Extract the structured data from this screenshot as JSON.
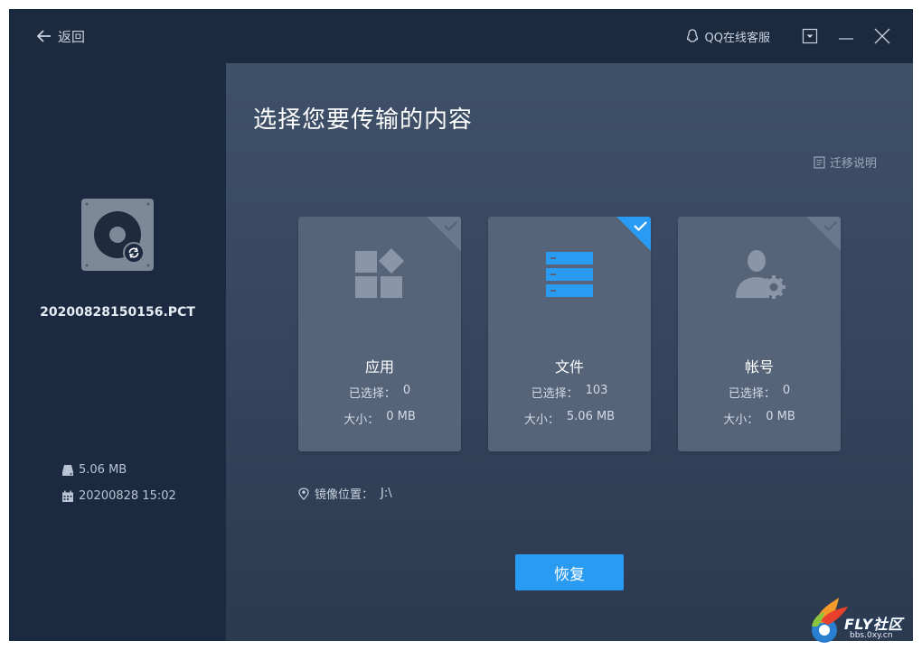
{
  "titlebar": {
    "back_label": "返回",
    "support_label": "QQ在线客服"
  },
  "sidebar": {
    "file_name": "20200828150156.PCT",
    "size": "5.06 MB",
    "date": "20200828 15:02"
  },
  "main": {
    "title": "选择您要传输的内容",
    "help_label": "迁移说明",
    "selected_label": "已选择：",
    "size_label": "大小：",
    "cards": [
      {
        "title": "应用",
        "selected": "0",
        "size": "0 MB",
        "checked": false
      },
      {
        "title": "文件",
        "selected": "103",
        "size": "5.06 MB",
        "checked": true
      },
      {
        "title": "帐号",
        "selected": "0",
        "size": "0 MB",
        "checked": false
      }
    ],
    "location_label": "镜像位置：",
    "location_value": "J:\\",
    "restore_label": "恢复"
  },
  "watermark": {
    "brand": "FLY社区",
    "url": "bbs.0xy.cn"
  },
  "colors": {
    "accent": "#2a9bf2",
    "sidebar_bg": "#1b2a40",
    "card_bg": "#56647a"
  }
}
